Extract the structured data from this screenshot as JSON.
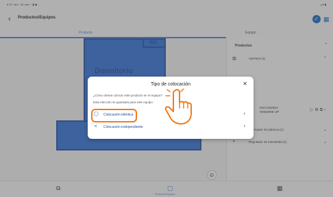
{
  "status_bar": {
    "left_text": "8:57 mié. 26 mar ▫ ▮ ◆ ·",
    "right_text": "⁎ ▾ ▮"
  },
  "header": {
    "title": "Productos/Equipos",
    "back_icon": "chevron-left-icon",
    "confirm_icon": "check-circle-icon",
    "grid_icon": "grid-icon"
  },
  "tabs": [
    {
      "label": "Producto",
      "active": true
    },
    {
      "label": "Equipo",
      "active": false
    }
  ],
  "floorplan": {
    "room_label": "Dormitorio",
    "wc_label": "WC"
  },
  "side_panel": {
    "section_title": "Productos",
    "items": [
      {
        "label": "Apertura (1)",
        "icon": "window-icon"
      },
      {
        "label": "Interruptor de palanca (1)",
        "icon": "switch-icon"
      },
      {
        "label": "Regulador de intensidad (1)",
        "icon": "dimmer-icon"
      }
    ],
    "product": {
      "line1": "ESCANDIDO",
      "line2": "WSB300E UP"
    }
  },
  "dialog": {
    "title": "Tipo de colocación",
    "question": "¿Cómo desea colocar este producto en el equipo?",
    "note": "Esta elección se guardará para este equipo.",
    "options": [
      {
        "label": "Colocación idéntica",
        "icon": "circle-icon",
        "highlighted": true
      },
      {
        "label": "Colocación independiente",
        "icon": "share-icon",
        "highlighted": false
      }
    ]
  },
  "bottom_nav": {
    "middle_label": "Productos/Equipos"
  },
  "colors": {
    "accent": "#1565c0",
    "plan_blue": "#2f6fd6",
    "highlight": "#f07b1d"
  }
}
